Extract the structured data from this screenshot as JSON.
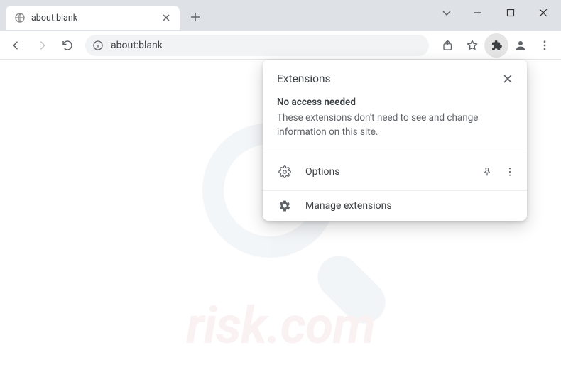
{
  "window": {
    "tab": {
      "title": "about:blank"
    },
    "url": "about:blank"
  },
  "popup": {
    "title": "Extensions",
    "no_access_heading": "No access needed",
    "no_access_desc": "These extensions don't need to see and change information on this site.",
    "row_options": "Options",
    "row_manage": "Manage extensions"
  },
  "watermark": {
    "text": "risk.com"
  }
}
